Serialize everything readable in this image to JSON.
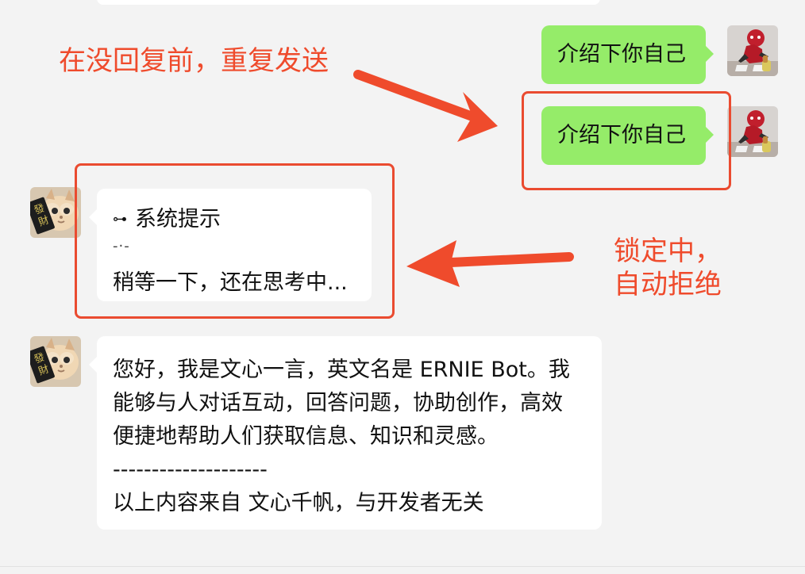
{
  "messages": {
    "user_message_1": "介绍下你自己",
    "user_message_2": "介绍下你自己",
    "system_prompt": {
      "title": "系统提示",
      "divider": "-·-",
      "body": "稍等一下，还在思考中..."
    },
    "reply": {
      "line1": "您好，我是文心一言，英文名是 ERNIE Bot。我",
      "line2": "能够与人对话互动，回答问题，协助创作，高效",
      "line3": "便捷地帮助人们获取信息、知识和灵感。",
      "divider": "--------------------",
      "footer": "以上内容来自 文心千帆，与开发者无关"
    }
  },
  "annotations": {
    "repeat_send": "在没回复前，重复发送",
    "locked": "锁定中，\n自动拒绝"
  },
  "avatars": {
    "user": {
      "label": "",
      "icon": "spiderman-figure-avatar"
    },
    "bot": {
      "badge_text": "發\n財",
      "icon": "cat-avatar"
    }
  },
  "colors": {
    "chat_background": "#f3f3f3",
    "user_bubble": "#95ec69",
    "bot_bubble": "#ffffff",
    "annotation_red": "#ef4b2c"
  }
}
